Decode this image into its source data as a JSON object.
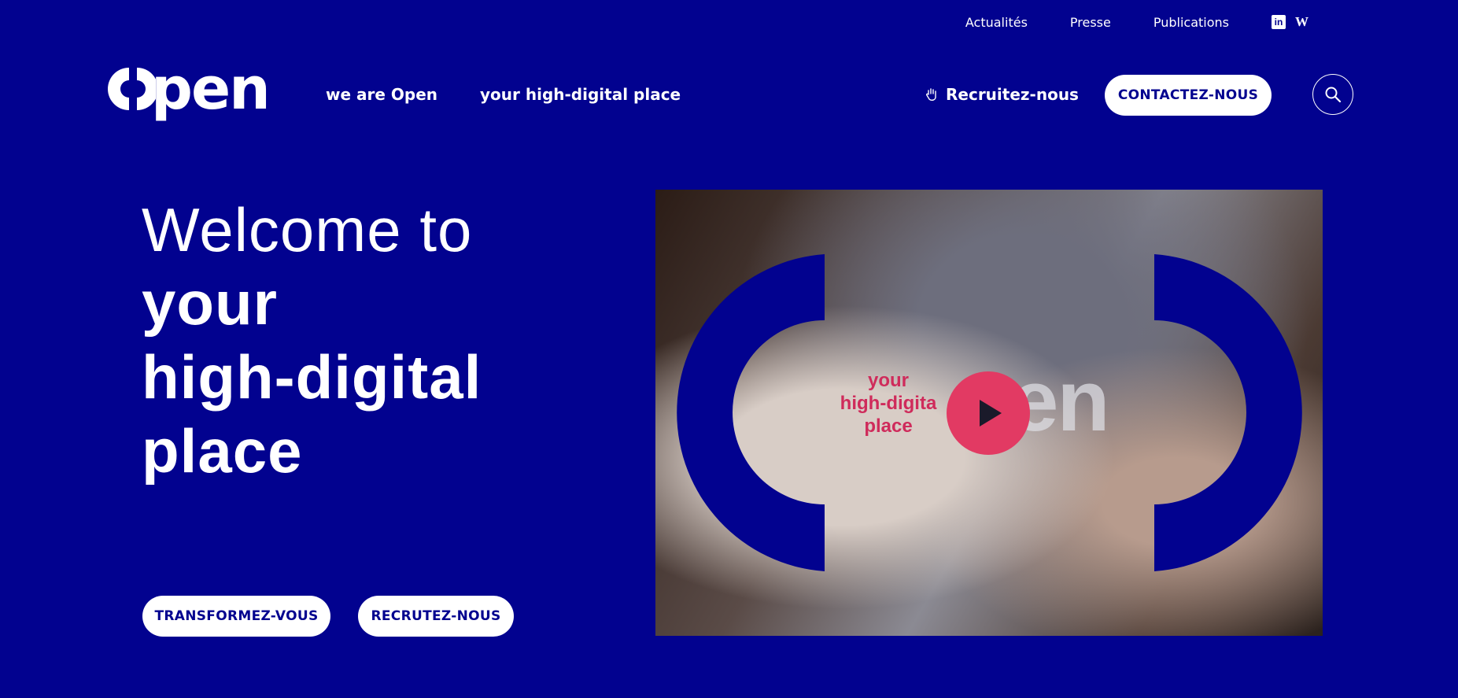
{
  "topbar": {
    "links": [
      "Actualités",
      "Presse",
      "Publications"
    ],
    "social": [
      {
        "icon": "linkedin-icon",
        "glyph": "in"
      },
      {
        "icon": "welcome-to-the-jungle-icon",
        "glyph": "W"
      }
    ]
  },
  "header": {
    "logo_text": "pen",
    "nav": [
      "we are Open",
      "your high-digital place"
    ],
    "recruit_label": "Recruitez-nous",
    "contact_label": "CONTACTEZ-NOUS",
    "search_icon": "search-icon"
  },
  "hero": {
    "line1": "Welcome to",
    "line2": "your",
    "line3": "high-digital",
    "line4": "place",
    "cta_primary": "TRANSFORMEZ-VOUS",
    "cta_secondary": "RECRUTEZ-NOUS"
  },
  "video": {
    "tagline_1": "your",
    "tagline_2": "high-digita",
    "tagline_3": "place",
    "brand_word": "pen",
    "play_icon": "play-icon"
  },
  "colors": {
    "background": "#02028f",
    "accent": "#e23a63",
    "text": "#ffffff"
  }
}
